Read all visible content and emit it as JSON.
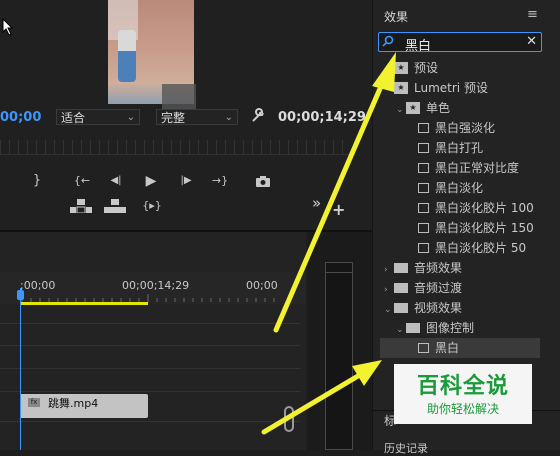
{
  "program_monitor": {
    "timecode_current": "00;00",
    "fit_select": "适合",
    "quality_select": "完整",
    "timecode_duration": "00;00;14;29"
  },
  "transport": {
    "mark_in": "{",
    "mark_out": "}",
    "go_in": "{←",
    "step_back": "◀|",
    "play": "▶",
    "step_fwd": "|▶",
    "go_out": "→}",
    "camera": "📷",
    "lift": "凸",
    "extract": "凹",
    "trim": "{▸}",
    "more": "»",
    "add": "+"
  },
  "timeline": {
    "tick_start": ";00;00",
    "tick_mid": "00;00;14;29",
    "tick_end": "00;00",
    "clip_label": "跳舞.mp4",
    "clip_fx": "fx"
  },
  "effects_panel": {
    "title": "效果",
    "search_value": "黑白",
    "tree": [
      {
        "label": "预设",
        "type": "star",
        "indent": 1,
        "arrow": ""
      },
      {
        "label": "Lumetri 预设",
        "type": "star",
        "indent": 1,
        "arrow": ""
      },
      {
        "label": "单色",
        "type": "star",
        "indent": 2,
        "arrow": "v"
      },
      {
        "label": "黑白强淡化",
        "type": "fx",
        "indent": 3,
        "arrow": ""
      },
      {
        "label": "黑白打孔",
        "type": "fx",
        "indent": 3,
        "arrow": ""
      },
      {
        "label": "黑白正常对比度",
        "type": "fx",
        "indent": 3,
        "arrow": ""
      },
      {
        "label": "黑白淡化",
        "type": "fx",
        "indent": 3,
        "arrow": ""
      },
      {
        "label": "黑白淡化胶片 100",
        "type": "fx",
        "indent": 3,
        "arrow": ""
      },
      {
        "label": "黑白淡化胶片 150",
        "type": "fx",
        "indent": 3,
        "arrow": ""
      },
      {
        "label": "黑白淡化胶片 50",
        "type": "fx",
        "indent": 3,
        "arrow": ""
      },
      {
        "label": "音频效果",
        "type": "folder",
        "indent": 1,
        "arrow": ">"
      },
      {
        "label": "音频过渡",
        "type": "folder",
        "indent": 1,
        "arrow": ">"
      },
      {
        "label": "视频效果",
        "type": "folder",
        "indent": 1,
        "arrow": "v"
      },
      {
        "label": "图像控制",
        "type": "folder",
        "indent": 2,
        "arrow": "v"
      },
      {
        "label": "黑白",
        "type": "fx",
        "indent": 3,
        "arrow": ""
      }
    ],
    "bottom_label_1": "标",
    "bottom_label_2": "历史记录"
  },
  "watermark": {
    "line1": "百科全说",
    "line2": "助你轻松解决"
  },
  "colors": {
    "accent_blue": "#3d96ff",
    "arrow_yellow": "#f2f230",
    "watermark_green": "#1a9a3a"
  }
}
